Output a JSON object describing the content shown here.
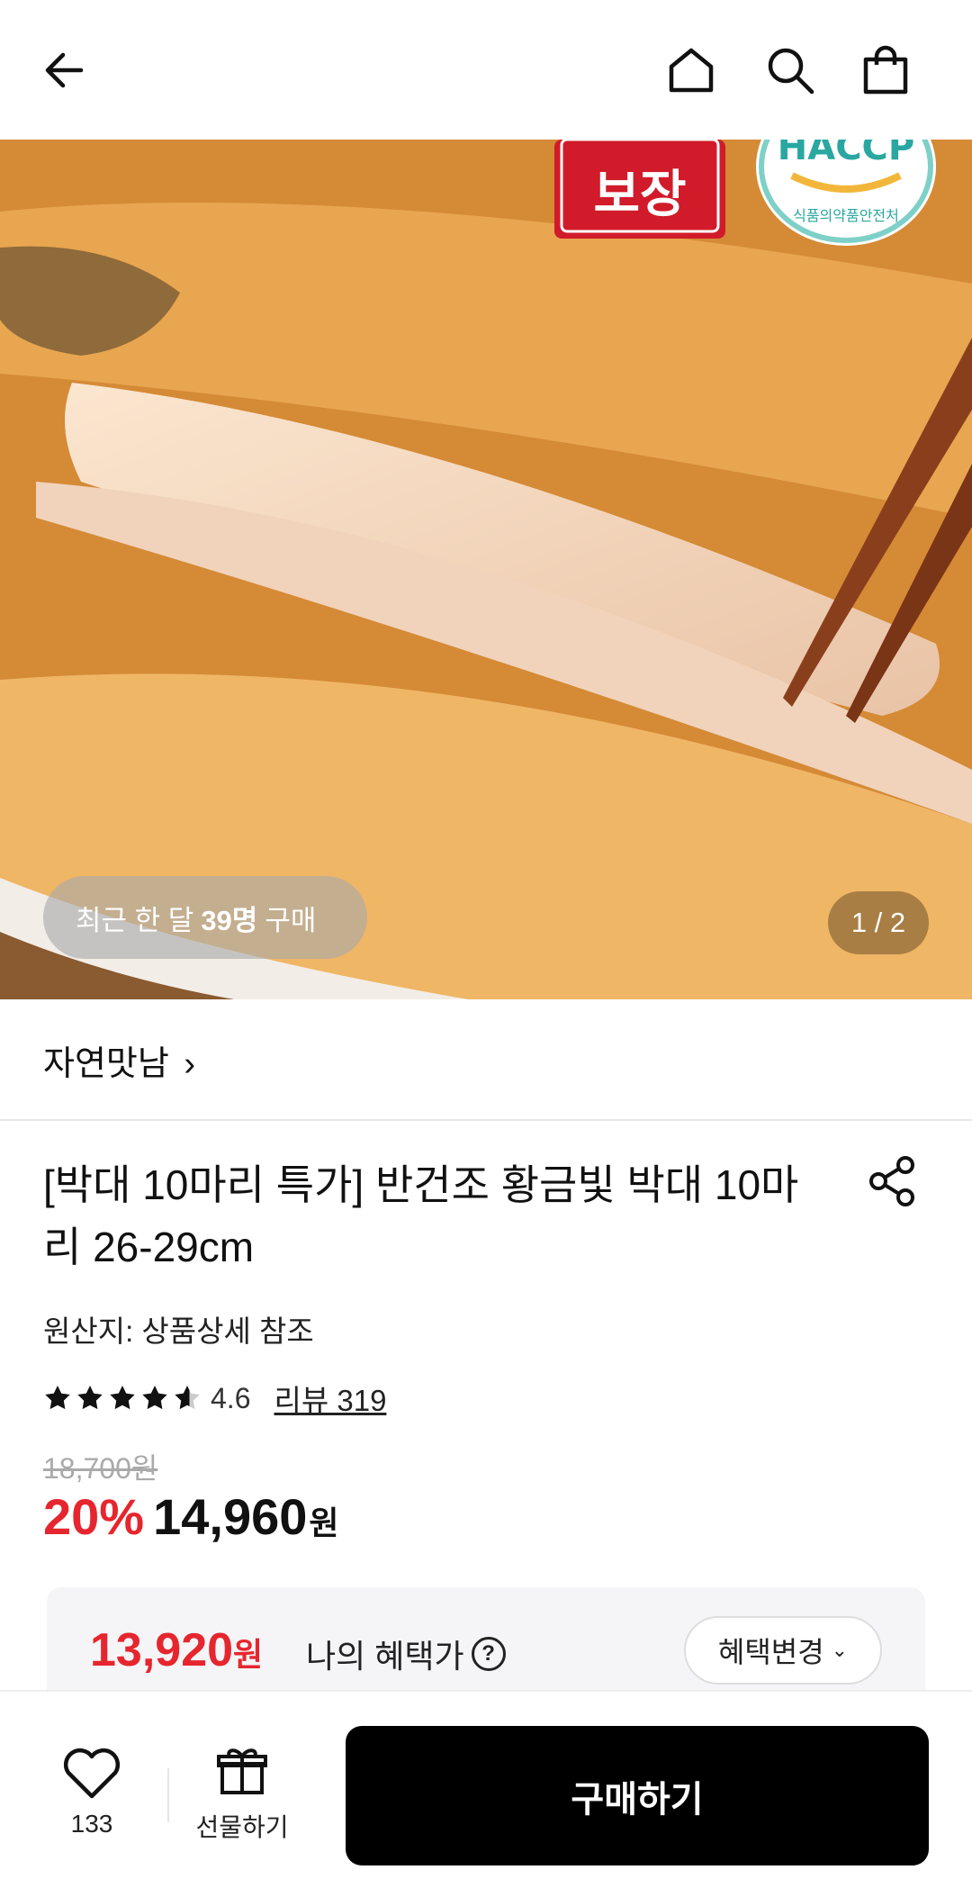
{
  "header": {
    "back_icon": "back-arrow-icon",
    "home_icon": "home-icon",
    "search_icon": "search-icon",
    "cart_icon": "shopping-bag-icon"
  },
  "hero": {
    "badge_text": "보장",
    "haccp_text": "HACCP",
    "haccp_sub": "식품의약품안전처",
    "recent_prefix": "최근 한 달",
    "recent_count": "39명",
    "recent_suffix": "구매",
    "page_indicator": "1 / 2"
  },
  "store": {
    "name": "자연맛남",
    "chevron": "›"
  },
  "product": {
    "title": "[박대 10마리 특가] 반건조 황금빛 박대 10마리 26-29cm",
    "origin": "원산지: 상품상세 참조",
    "rating": "4.6",
    "rating_value": 4.6,
    "review_link": "리뷰 319",
    "original_price": "18,700원",
    "discount": "20%",
    "price": "14,960",
    "price_unit": "원"
  },
  "benefit": {
    "price": "13,920",
    "price_unit": "원",
    "label": "나의 혜택가",
    "change_button": "혜택변경"
  },
  "bottom_bar": {
    "like_count": "133",
    "gift_label": "선물하기",
    "buy_label": "구매하기"
  },
  "colors": {
    "accent_red": "#e6262e",
    "buy_button": "#000000"
  }
}
